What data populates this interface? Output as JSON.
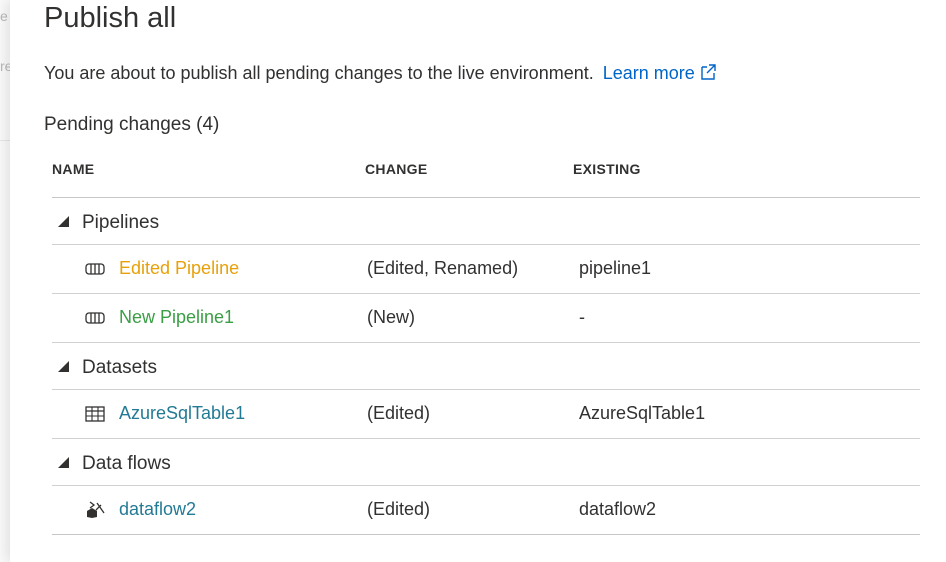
{
  "background_ghost": [
    "e",
    "re"
  ],
  "dialog": {
    "title": "Publish all",
    "description": "You are about to publish all pending changes to the live environment.",
    "learn_more": "Learn more",
    "pending_heading": "Pending changes (4)"
  },
  "table": {
    "columns": {
      "name": "NAME",
      "change": "CHANGE",
      "existing": "EXISTING"
    },
    "groups": [
      {
        "label": "Pipelines",
        "rows": [
          {
            "name": "Edited Pipeline",
            "change": "(Edited, Renamed)",
            "existing": "pipeline1",
            "icon": "pipeline-icon",
            "color": "#e8a10a"
          },
          {
            "name": "New Pipeline1",
            "change": "(New)",
            "existing": "-",
            "icon": "pipeline-icon",
            "color": "#3a9e45"
          }
        ]
      },
      {
        "label": "Datasets",
        "rows": [
          {
            "name": "AzureSqlTable1",
            "change": "(Edited)",
            "existing": "AzureSqlTable1",
            "icon": "table-icon",
            "color": "#237a95"
          }
        ]
      },
      {
        "label": "Data flows",
        "rows": [
          {
            "name": "dataflow2",
            "change": "(Edited)",
            "existing": "dataflow2",
            "icon": "dataflow-icon",
            "color": "#237a95"
          }
        ]
      }
    ]
  },
  "colors": {
    "link": "#0064c8",
    "edited": "#e8a10a",
    "new": "#3a9e45",
    "existing_item": "#237a95"
  }
}
